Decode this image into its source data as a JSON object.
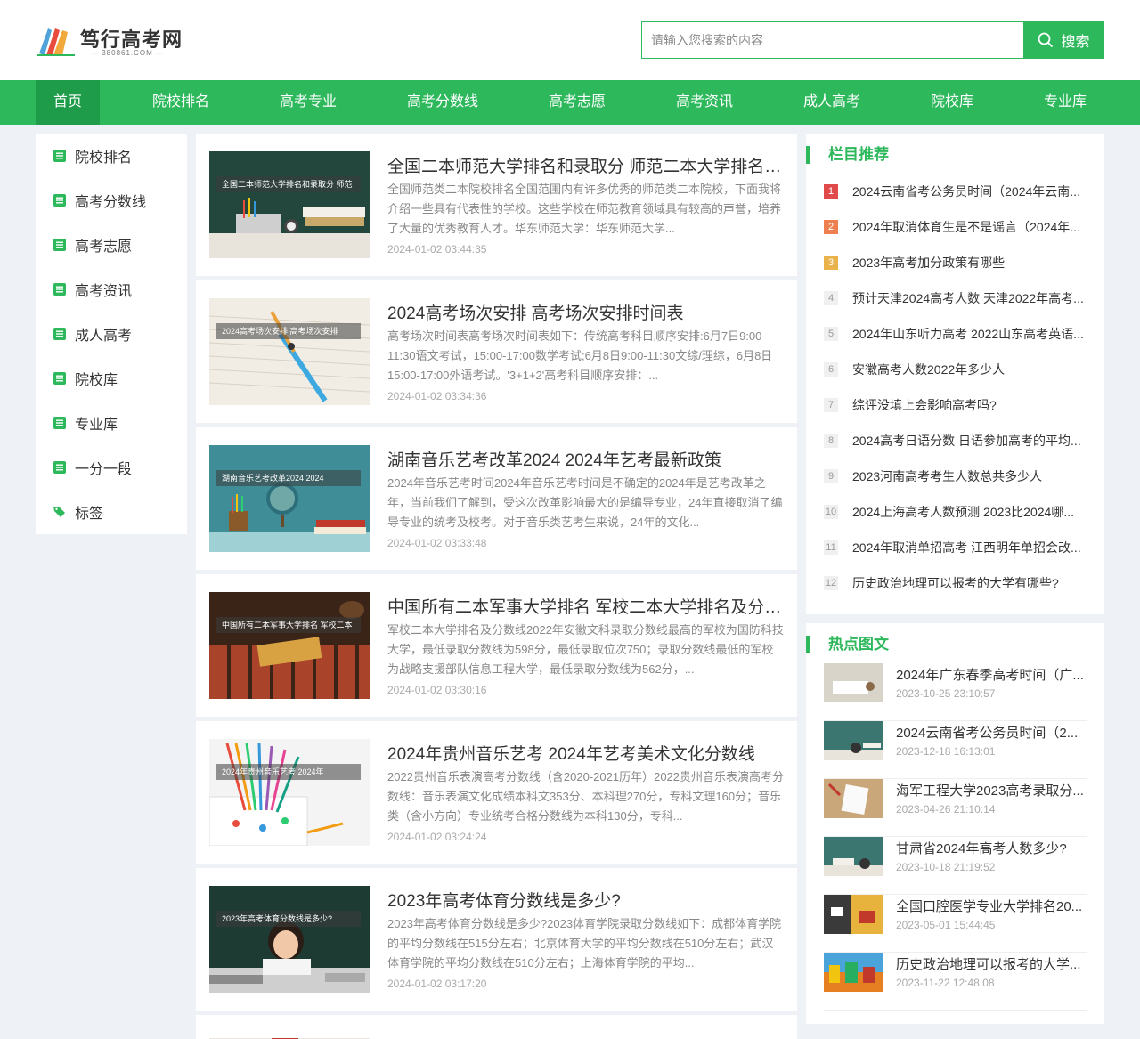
{
  "site": {
    "logo_text": "笃行高考网",
    "logo_sub": "— 380861.COM —"
  },
  "search": {
    "placeholder": "请输入您搜索的内容",
    "button_label": "搜索"
  },
  "nav": [
    {
      "label": "首页",
      "active": true
    },
    {
      "label": "院校排名"
    },
    {
      "label": "高考专业"
    },
    {
      "label": "高考分数线"
    },
    {
      "label": "高考志愿"
    },
    {
      "label": "高考资讯"
    },
    {
      "label": "成人高考"
    },
    {
      "label": "院校库"
    },
    {
      "label": "专业库"
    }
  ],
  "sidebar": [
    {
      "label": "院校排名",
      "icon": "list-icon"
    },
    {
      "label": "高考分数线",
      "icon": "list-icon"
    },
    {
      "label": "高考志愿",
      "icon": "list-icon"
    },
    {
      "label": "高考资讯",
      "icon": "list-icon"
    },
    {
      "label": "成人高考",
      "icon": "list-icon"
    },
    {
      "label": "院校库",
      "icon": "list-icon"
    },
    {
      "label": "专业库",
      "icon": "list-icon"
    },
    {
      "label": "一分一段",
      "icon": "list-icon"
    },
    {
      "label": "标签",
      "icon": "tag-icon"
    }
  ],
  "articles": [
    {
      "thumb_caption": "全国二本师范大学排名和录取分 师范",
      "title": "全国二本师范大学排名和录取分 师范二本大学排名及...",
      "desc": "全国师范类二本院校排名全国范围内有许多优秀的师范类二本院校，下面我将介绍一些具有代表性的学校。这些学校在师范教育领域具有较高的声誉，培养了大量的优秀教育人才。华东师范大学：华东师范大学...",
      "date": "2024-01-02 03:44:35"
    },
    {
      "thumb_caption": "2024高考场次安排 高考场次安排",
      "title": "2024高考场次安排 高考场次安排时间表",
      "desc": "高考场次时间表高考场次时间表如下：传统高考科目顺序安排:6月7日9:00-11:30语文考试，15:00-17:00数学考试;6月8日9:00-11:30文综/理综，6月8日15:00-17:00外语考试。'3+1+2'高考科目顺序安排：...",
      "date": "2024-01-02 03:34:36"
    },
    {
      "thumb_caption": "湖南音乐艺考改革2024 2024",
      "title": "湖南音乐艺考改革2024 2024年艺考最新政策",
      "desc": "2024年音乐艺考时间2024年音乐艺考时间是不确定的2024年是艺考改革之年，当前我们了解到，受这次改革影响最大的是编导专业，24年直接取消了编导专业的统考及校考。对于音乐类艺考生来说，24年的文化...",
      "date": "2024-01-02 03:33:48"
    },
    {
      "thumb_caption": "中国所有二本军事大学排名 军校二本",
      "title": "中国所有二本军事大学排名 军校二本大学排名及分数线",
      "desc": "军校二本大学排名及分数线2022年安徽文科录取分数线最高的军校为国防科技大学，最低录取分数线为598分，最低录取位次750；录取分数线最低的军校为战略支援部队信息工程大学，最低录取分数线为562分，...",
      "date": "2024-01-02 03:30:16"
    },
    {
      "thumb_caption": "2024年贵州音乐艺考 2024年",
      "title": "2024年贵州音乐艺考 2024年艺考美术文化分数线",
      "desc": "2022贵州音乐表演高考分数线（含2020-2021历年）2022贵州音乐表演高考分数线：音乐表演文化成绩本科文353分、本科理270分，专科文理160分；音乐类（含小方向）专业统考合格分数线为本科130分，专科...",
      "date": "2024-01-02 03:24:24"
    },
    {
      "thumb_caption": "2023年高考体育分数线是多少?",
      "title": "2023年高考体育分数线是多少?",
      "desc": "2023年高考体育分数线是多少?2023体育学院录取分数线如下：成都体育学院的平均分数线在515分左右；北京体育大学的平均分数线在510分左右；武汉体育学院的平均分数线在510分左右；上海体育学院的平均...",
      "date": "2024-01-02 03:17:20"
    }
  ],
  "column_recommend": {
    "title": "栏目推荐",
    "items": [
      "2024云南省考公务员时间（2024年云南...",
      "2024年取消体育生是不是谣言（2024年...",
      "2023年高考加分政策有哪些",
      "预计天津2024高考人数 天津2022年高考...",
      "2024年山东听力高考 2022山东高考英语...",
      "安徽高考人数2022年多少人",
      "综评没填上会影响高考吗?",
      "2024高考日语分数 日语参加高考的平均...",
      "2023河南高考考生人数总共多少人",
      "2024上海高考人数预测 2023比2024哪...",
      "2024年取消单招高考 江西明年单招会改...",
      "历史政治地理可以报考的大学有哪些?"
    ]
  },
  "hot_pics": {
    "title": "热点图文",
    "items": [
      {
        "title": "2024年广东春季高考时间（广...",
        "date": "2023-10-25 23:10:57"
      },
      {
        "title": "2024云南省考公务员时间（2...",
        "date": "2023-12-18 16:13:01"
      },
      {
        "title": "海军工程大学2023高考录取分...",
        "date": "2023-04-26 21:10:14"
      },
      {
        "title": "甘肃省2024年高考人数多少?",
        "date": "2023-10-18 21:19:52"
      },
      {
        "title": "全国口腔医学专业大学排名20...",
        "date": "2023-05-01 15:44:45"
      },
      {
        "title": "历史政治地理可以报考的大学...",
        "date": "2023-11-22 12:48:08"
      }
    ]
  },
  "colors": {
    "brand": "#2eb85c",
    "nav_active": "#1f9c4a",
    "rank1": "#e04a4a",
    "rank2": "#ef7f4f",
    "rank3": "#e9b24a"
  }
}
